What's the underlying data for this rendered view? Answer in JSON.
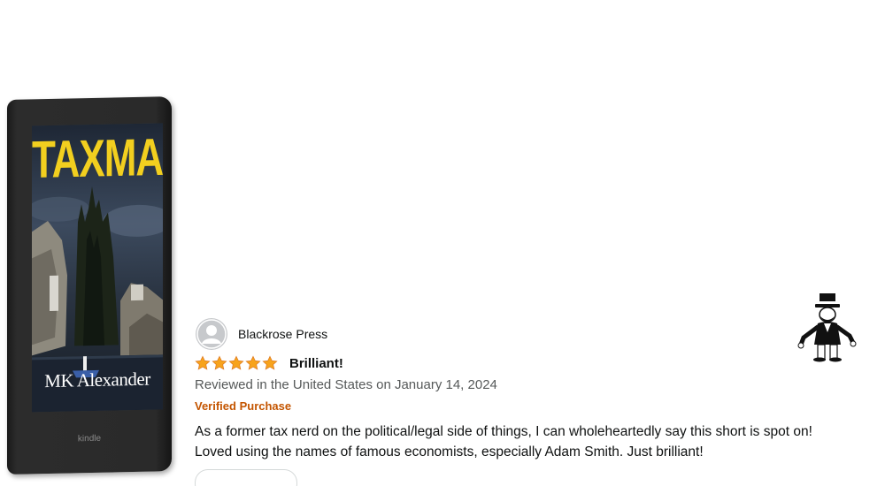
{
  "book": {
    "cover_title": "TAXMAN",
    "cover_author": "MK Alexander",
    "device_label": "kindle"
  },
  "review": {
    "reviewer_name": "Blackrose Press",
    "rating": 5,
    "rating_max": 5,
    "title": "Brilliant!",
    "meta": "Reviewed in the United States on January 14, 2024",
    "verified": "Verified Purchase",
    "body_lines": [
      "As a former tax nerd on the political/legal side of things, I can wholeheartedly say this short is spot on!",
      "Loved using the names of famous economists, especially Adam Smith. Just brilliant!"
    ]
  },
  "colors": {
    "star": "#f7a31c",
    "verified": "#c45500",
    "cover_title": "#f2cf1f"
  },
  "icons": {
    "avatar": "default-user-avatar-icon",
    "star": "star-icon",
    "mascot": "monopoly-man-icon"
  }
}
